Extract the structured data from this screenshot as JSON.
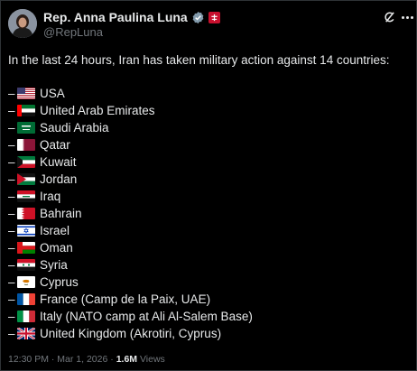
{
  "post": {
    "author_name": "Rep. Anna Paulina Luna",
    "handle": "@RepLuna",
    "intro": "In the last 24 hours, Iran has taken military action against 14 countries:",
    "dash": "–",
    "items": [
      {
        "label": "USA",
        "flag": "us-flag"
      },
      {
        "label": "United Arab Emirates",
        "flag": "uae-flag"
      },
      {
        "label": "Saudi Arabia",
        "flag": "saudi-flag"
      },
      {
        "label": "Qatar",
        "flag": "qatar-flag"
      },
      {
        "label": "Kuwait",
        "flag": "kuwait-flag"
      },
      {
        "label": "Jordan",
        "flag": "jordan-flag"
      },
      {
        "label": "Iraq",
        "flag": "iraq-flag"
      },
      {
        "label": "Bahrain",
        "flag": "bahrain-flag"
      },
      {
        "label": "Israel",
        "flag": "israel-flag"
      },
      {
        "label": "Oman",
        "flag": "oman-flag"
      },
      {
        "label": "Syria",
        "flag": "syria-flag"
      },
      {
        "label": "Cyprus",
        "flag": "cyprus-flag"
      },
      {
        "label": "France (Camp de la Paix, UAE)",
        "flag": "france-flag"
      },
      {
        "label": "Italy (NATO camp at Ali Al-Salem Base)",
        "flag": "italy-flag"
      },
      {
        "label": "United Kingdom (Akrotiri, Cyprus)",
        "flag": "uk-flag"
      }
    ],
    "time": "12:30 PM",
    "separator": "·",
    "date": "Mar 1, 2026",
    "views_count": "1.6M",
    "views_label": "Views"
  },
  "colors": {
    "background": "#000000",
    "text": "#e7e9ea",
    "muted": "#71767b",
    "verified": "#1d9bf0"
  },
  "icons": [
    "verified-badge-icon",
    "affiliation-badge-icon",
    "grok-icon",
    "more-icon"
  ]
}
